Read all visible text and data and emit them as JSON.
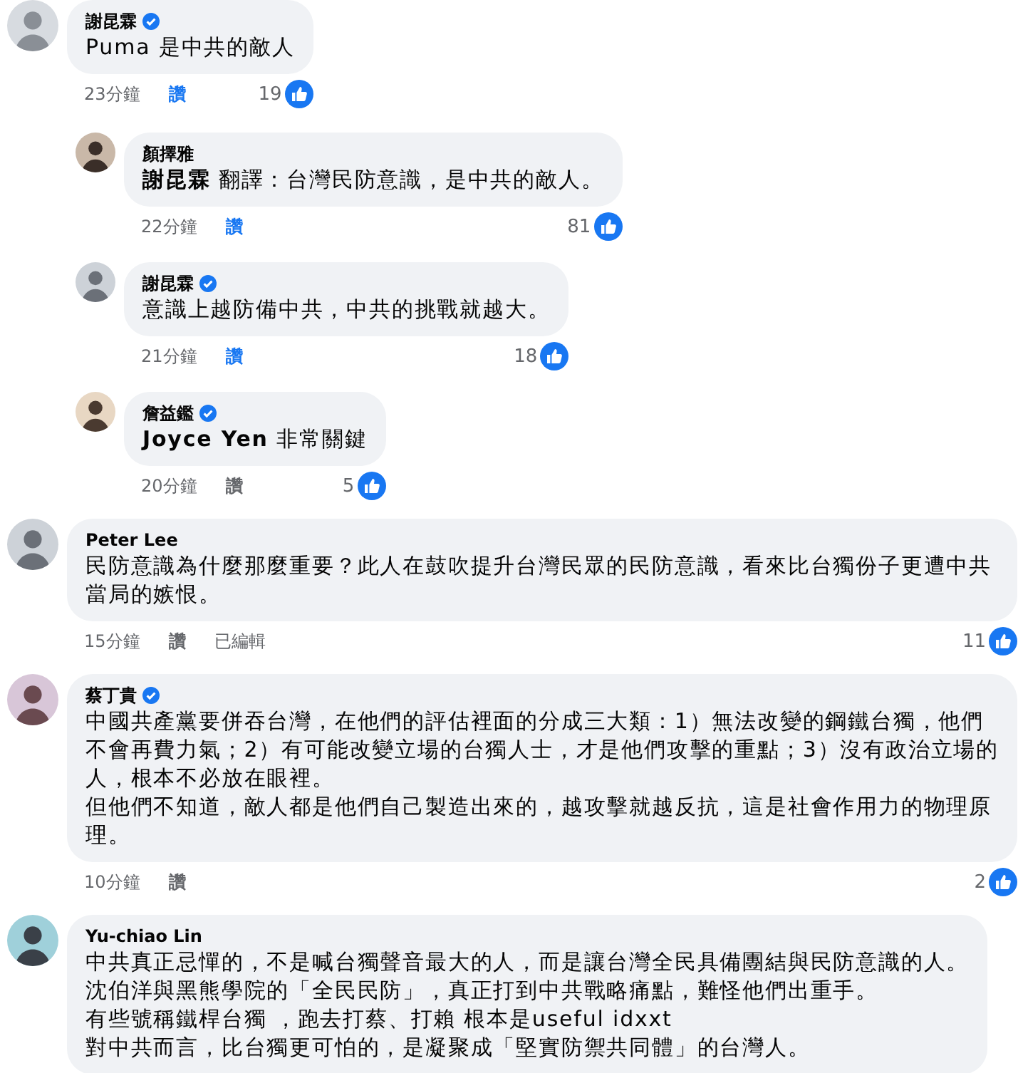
{
  "comments": [
    {
      "author": "謝昆霖",
      "verified": true,
      "text": "Puma 是中共的敵人",
      "time": "23分鐘",
      "like_label": "讚",
      "liked": true,
      "reactions": "19",
      "children": [
        {
          "author": "顏擇雅",
          "verified": false,
          "text": "**謝昆霖** 翻譯：台灣民防意識，是中共的敵人。",
          "time": "22分鐘",
          "like_label": "讚",
          "liked": true,
          "reactions": "81"
        },
        {
          "author": "謝昆霖",
          "verified": true,
          "text": "意識上越防備中共，中共的挑戰就越大。",
          "time": "21分鐘",
          "like_label": "讚",
          "liked": true,
          "reactions": "18"
        },
        {
          "author": "詹益鑑",
          "verified": true,
          "text": "**Joyce Yen** 非常關鍵",
          "time": "20分鐘",
          "like_label": "讚",
          "liked": false,
          "reactions": "5"
        }
      ]
    },
    {
      "author": "Peter Lee",
      "verified": false,
      "text": "民防意識為什麼那麼重要？此人在鼓吹提升台灣民眾的民防意識，看來比台獨份子更遭中共當局的嫉恨。",
      "time": "15分鐘",
      "like_label": "讚",
      "liked": false,
      "edited": "已編輯",
      "reactions": "11"
    },
    {
      "author": "蔡丁貴",
      "verified": true,
      "paragraphs": [
        "中國共產黨要併吞台灣，在他們的評估裡面的分成三大類：1）無法改變的鋼鐵台獨，他們不會再費力氣；2）有可能改變立場的台獨人士，才是他們攻擊的重點；3）沒有政治立場的人，根本不必放在眼裡。",
        "但他們不知道，敵人都是他們自己製造出來的，越攻擊就越反抗，這是社會作用力的物理原理。"
      ],
      "time": "10分鐘",
      "like_label": "讚",
      "liked": false,
      "reactions": "2"
    },
    {
      "author": "Yu-chiao Lin",
      "verified": false,
      "paragraphs": [
        "中共真正忌憚的，不是喊台獨聲音最大的人，而是讓台灣全民具備團結與民防意識的人。",
        "沈伯洋與黑熊學院的「全民民防」，真正打到中共戰略痛點，難怪他們出重手。",
        "有些號稱鐵桿台獨 ，跑去打蔡、打賴 根本是useful idxxt",
        "對中共而言，比台獨更可怕的，是凝聚成「堅實防禦共同體」的台灣人。"
      ]
    }
  ]
}
